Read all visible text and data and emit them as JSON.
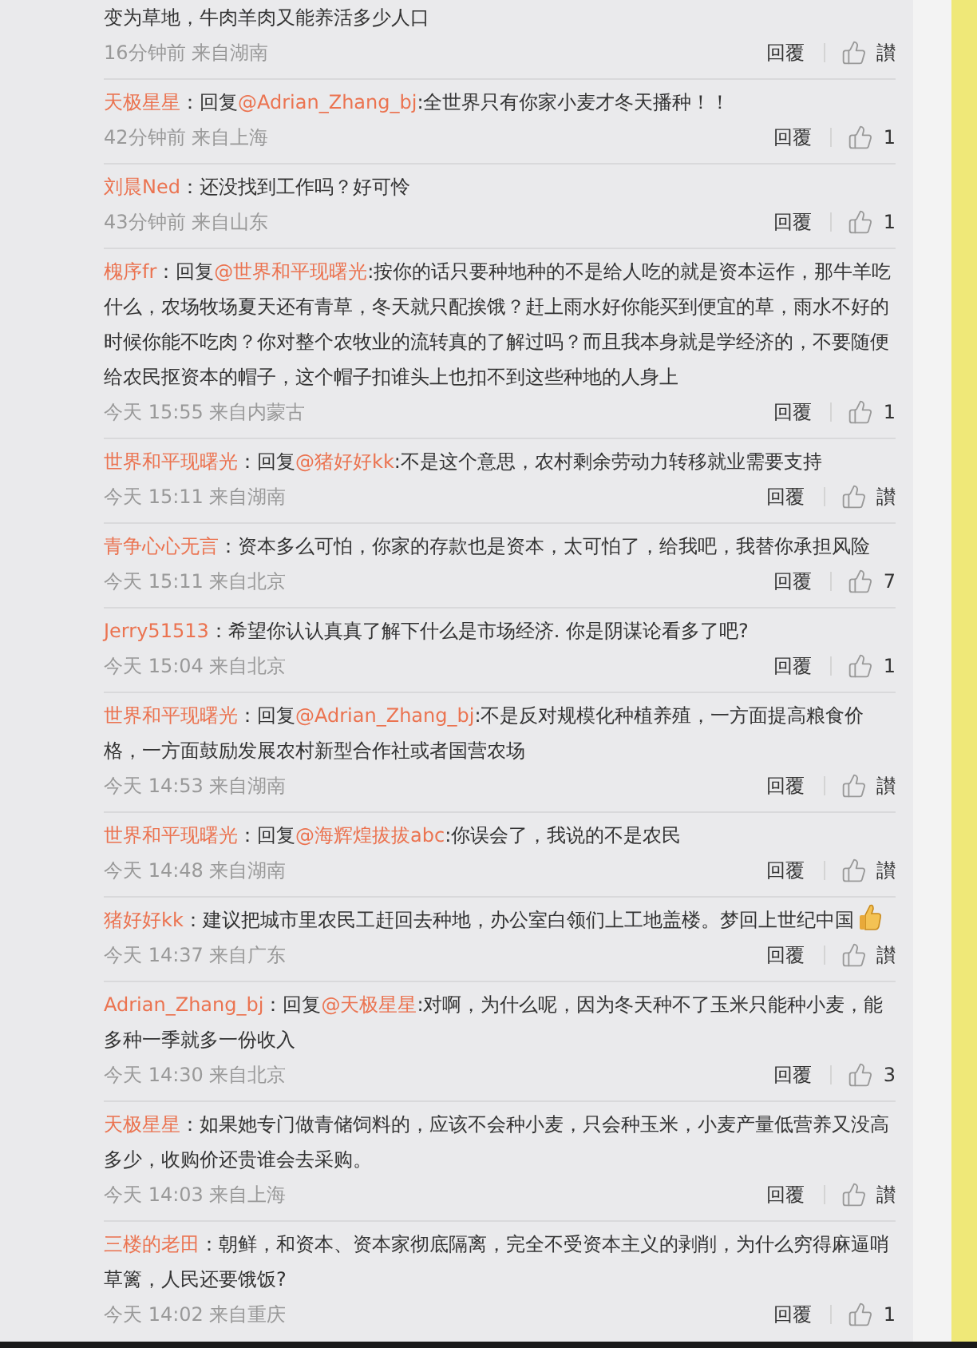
{
  "comments": [
    {
      "text": "变为草地，牛肉羊肉又能养活多少人口",
      "time": "16分钟前",
      "source": "来自湖南",
      "reply_label": "回覆",
      "likes": "讃",
      "emoji": false
    },
    {
      "author": "天极星星",
      "prefix": "：回复",
      "mention": "@Adrian_Zhang_bj",
      "text": ":全世界只有你家小麦才冬天播种！！",
      "time": "42分钟前",
      "source": "来自上海",
      "reply_label": "回覆",
      "likes": "1",
      "emoji": false
    },
    {
      "author": "刘晨Ned",
      "text": "：还没找到工作吗？好可怜",
      "time": "43分钟前",
      "source": "来自山东",
      "reply_label": "回覆",
      "likes": "1",
      "emoji": false
    },
    {
      "author": "槐序fr",
      "prefix": "：回复",
      "mention": "@世界和平现曙光",
      "text": ":按你的话只要种地种的不是给人吃的就是资本运作，那牛羊吃什么，农场牧场夏天还有青草，冬天就只配挨饿？赶上雨水好你能买到便宜的草，雨水不好的时候你能不吃肉？你对整个农牧业的流转真的了解过吗？而且我本身就是学经济的，不要随便给农民抠资本的帽子，这个帽子扣谁头上也扣不到这些种地的人身上",
      "time": "今天 15:55",
      "source": "来自内蒙古",
      "reply_label": "回覆",
      "likes": "1",
      "emoji": false
    },
    {
      "author": "世界和平现曙光",
      "prefix": "：回复",
      "mention": "@猪好好kk",
      "text": ":不是这个意思，农村剩余劳动力转移就业需要支持",
      "time": "今天 15:11",
      "source": "来自湖南",
      "reply_label": "回覆",
      "likes": "讃",
      "emoji": false
    },
    {
      "author": "青争心心无言",
      "text": "：资本多么可怕，你家的存款也是资本，太可怕了，给我吧，我替你承担风险",
      "time": "今天 15:11",
      "source": "来自北京",
      "reply_label": "回覆",
      "likes": "7",
      "emoji": false
    },
    {
      "author": "Jerry51513",
      "text": "：希望你认认真真了解下什么是市场经济. 你是阴谋论看多了吧?",
      "time": "今天 15:04",
      "source": "来自北京",
      "reply_label": "回覆",
      "likes": "1",
      "emoji": false
    },
    {
      "author": "世界和平现曙光",
      "prefix": "：回复",
      "mention": "@Adrian_Zhang_bj",
      "text": ":不是反对规模化种植养殖，一方面提高粮食价格，一方面鼓励发展农村新型合作社或者国营农场",
      "time": "今天 14:53",
      "source": "来自湖南",
      "reply_label": "回覆",
      "likes": "讃",
      "emoji": false
    },
    {
      "author": "世界和平现曙光",
      "prefix": "：回复",
      "mention": "@海辉煌拔拔abc",
      "text": ":你误会了，我说的不是农民",
      "time": "今天 14:48",
      "source": "来自湖南",
      "reply_label": "回覆",
      "likes": "讃",
      "emoji": false
    },
    {
      "author": "猪好好kk",
      "text": "：建议把城市里农民工赶回去种地，办公室白领们上工地盖楼。梦回上世纪中国",
      "time": "今天 14:37",
      "source": "来自广东",
      "reply_label": "回覆",
      "likes": "讃",
      "emoji": true
    },
    {
      "author": "Adrian_Zhang_bj",
      "prefix": "：回复",
      "mention": "@天极星星",
      "text": ":对啊，为什么呢，因为冬天种不了玉米只能种小麦，能多种一季就多一份收入",
      "time": "今天 14:30",
      "source": "来自北京",
      "reply_label": "回覆",
      "likes": "3",
      "emoji": false
    },
    {
      "author": "天极星星",
      "text": "：如果她专门做青储饲料的，应该不会种小麦，只会种玉米，小麦产量低营养又没高多少，收购价还贵谁会去采购。",
      "time": "今天 14:03",
      "source": "来自上海",
      "reply_label": "回覆",
      "likes": "讃",
      "emoji": false
    },
    {
      "author": "三楼的老田",
      "text": "：朝鲜，和资本、资本家彻底隔离，完全不受资本主义的剥削，为什么穷得麻逼哨草篱，人民还要饿饭?",
      "time": "今天 14:02",
      "source": "来自重庆",
      "reply_label": "回覆",
      "likes": "1",
      "emoji": false
    }
  ]
}
